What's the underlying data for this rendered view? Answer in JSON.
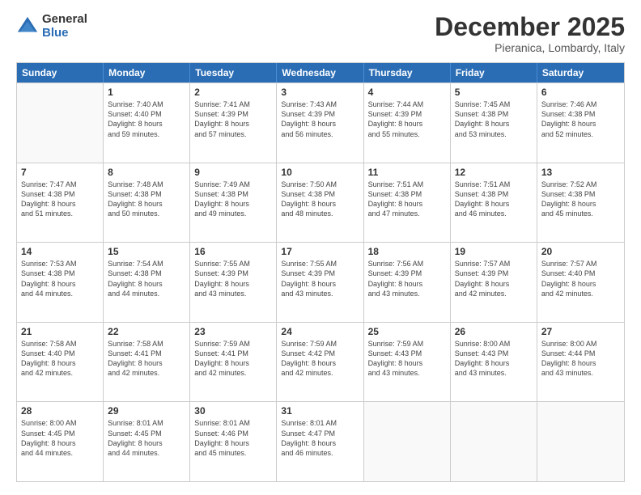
{
  "logo": {
    "general": "General",
    "blue": "Blue"
  },
  "title": "December 2025",
  "subtitle": "Pieranica, Lombardy, Italy",
  "headers": [
    "Sunday",
    "Monday",
    "Tuesday",
    "Wednesday",
    "Thursday",
    "Friday",
    "Saturday"
  ],
  "weeks": [
    [
      {
        "day": "",
        "info": ""
      },
      {
        "day": "1",
        "info": "Sunrise: 7:40 AM\nSunset: 4:40 PM\nDaylight: 8 hours\nand 59 minutes."
      },
      {
        "day": "2",
        "info": "Sunrise: 7:41 AM\nSunset: 4:39 PM\nDaylight: 8 hours\nand 57 minutes."
      },
      {
        "day": "3",
        "info": "Sunrise: 7:43 AM\nSunset: 4:39 PM\nDaylight: 8 hours\nand 56 minutes."
      },
      {
        "day": "4",
        "info": "Sunrise: 7:44 AM\nSunset: 4:39 PM\nDaylight: 8 hours\nand 55 minutes."
      },
      {
        "day": "5",
        "info": "Sunrise: 7:45 AM\nSunset: 4:38 PM\nDaylight: 8 hours\nand 53 minutes."
      },
      {
        "day": "6",
        "info": "Sunrise: 7:46 AM\nSunset: 4:38 PM\nDaylight: 8 hours\nand 52 minutes."
      }
    ],
    [
      {
        "day": "7",
        "info": "Sunrise: 7:47 AM\nSunset: 4:38 PM\nDaylight: 8 hours\nand 51 minutes."
      },
      {
        "day": "8",
        "info": "Sunrise: 7:48 AM\nSunset: 4:38 PM\nDaylight: 8 hours\nand 50 minutes."
      },
      {
        "day": "9",
        "info": "Sunrise: 7:49 AM\nSunset: 4:38 PM\nDaylight: 8 hours\nand 49 minutes."
      },
      {
        "day": "10",
        "info": "Sunrise: 7:50 AM\nSunset: 4:38 PM\nDaylight: 8 hours\nand 48 minutes."
      },
      {
        "day": "11",
        "info": "Sunrise: 7:51 AM\nSunset: 4:38 PM\nDaylight: 8 hours\nand 47 minutes."
      },
      {
        "day": "12",
        "info": "Sunrise: 7:51 AM\nSunset: 4:38 PM\nDaylight: 8 hours\nand 46 minutes."
      },
      {
        "day": "13",
        "info": "Sunrise: 7:52 AM\nSunset: 4:38 PM\nDaylight: 8 hours\nand 45 minutes."
      }
    ],
    [
      {
        "day": "14",
        "info": "Sunrise: 7:53 AM\nSunset: 4:38 PM\nDaylight: 8 hours\nand 44 minutes."
      },
      {
        "day": "15",
        "info": "Sunrise: 7:54 AM\nSunset: 4:38 PM\nDaylight: 8 hours\nand 44 minutes."
      },
      {
        "day": "16",
        "info": "Sunrise: 7:55 AM\nSunset: 4:39 PM\nDaylight: 8 hours\nand 43 minutes."
      },
      {
        "day": "17",
        "info": "Sunrise: 7:55 AM\nSunset: 4:39 PM\nDaylight: 8 hours\nand 43 minutes."
      },
      {
        "day": "18",
        "info": "Sunrise: 7:56 AM\nSunset: 4:39 PM\nDaylight: 8 hours\nand 43 minutes."
      },
      {
        "day": "19",
        "info": "Sunrise: 7:57 AM\nSunset: 4:39 PM\nDaylight: 8 hours\nand 42 minutes."
      },
      {
        "day": "20",
        "info": "Sunrise: 7:57 AM\nSunset: 4:40 PM\nDaylight: 8 hours\nand 42 minutes."
      }
    ],
    [
      {
        "day": "21",
        "info": "Sunrise: 7:58 AM\nSunset: 4:40 PM\nDaylight: 8 hours\nand 42 minutes."
      },
      {
        "day": "22",
        "info": "Sunrise: 7:58 AM\nSunset: 4:41 PM\nDaylight: 8 hours\nand 42 minutes."
      },
      {
        "day": "23",
        "info": "Sunrise: 7:59 AM\nSunset: 4:41 PM\nDaylight: 8 hours\nand 42 minutes."
      },
      {
        "day": "24",
        "info": "Sunrise: 7:59 AM\nSunset: 4:42 PM\nDaylight: 8 hours\nand 42 minutes."
      },
      {
        "day": "25",
        "info": "Sunrise: 7:59 AM\nSunset: 4:43 PM\nDaylight: 8 hours\nand 43 minutes."
      },
      {
        "day": "26",
        "info": "Sunrise: 8:00 AM\nSunset: 4:43 PM\nDaylight: 8 hours\nand 43 minutes."
      },
      {
        "day": "27",
        "info": "Sunrise: 8:00 AM\nSunset: 4:44 PM\nDaylight: 8 hours\nand 43 minutes."
      }
    ],
    [
      {
        "day": "28",
        "info": "Sunrise: 8:00 AM\nSunset: 4:45 PM\nDaylight: 8 hours\nand 44 minutes."
      },
      {
        "day": "29",
        "info": "Sunrise: 8:01 AM\nSunset: 4:45 PM\nDaylight: 8 hours\nand 44 minutes."
      },
      {
        "day": "30",
        "info": "Sunrise: 8:01 AM\nSunset: 4:46 PM\nDaylight: 8 hours\nand 45 minutes."
      },
      {
        "day": "31",
        "info": "Sunrise: 8:01 AM\nSunset: 4:47 PM\nDaylight: 8 hours\nand 46 minutes."
      },
      {
        "day": "",
        "info": ""
      },
      {
        "day": "",
        "info": ""
      },
      {
        "day": "",
        "info": ""
      }
    ]
  ]
}
